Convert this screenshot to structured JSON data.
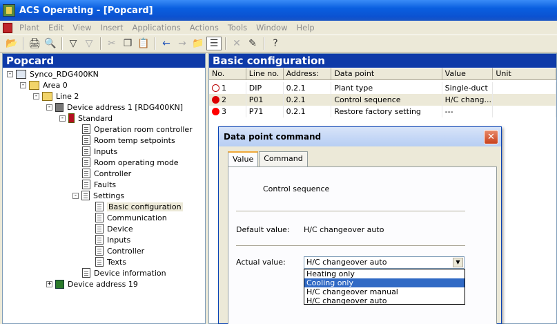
{
  "window": {
    "title": "ACS Operating - [Popcard]"
  },
  "menu": [
    "Plant",
    "Edit",
    "View",
    "Insert",
    "Applications",
    "Actions",
    "Tools",
    "Window",
    "Help"
  ],
  "left": {
    "header": "Popcard",
    "tree": {
      "root": "Synco_RDG400KN",
      "area": "Area 0",
      "line": "Line 2",
      "device": "Device address 1 [RDG400KN]",
      "standard": "Standard",
      "items": [
        "Operation room controller",
        "Room temp setpoints",
        "Inputs",
        "Room operating mode",
        "Controller",
        "Faults",
        "Settings"
      ],
      "settings": [
        "Basic configuration",
        "Communication",
        "Device",
        "Inputs",
        "Controller",
        "Texts"
      ],
      "devinfo": "Device information",
      "device19": "Device address 19"
    }
  },
  "right": {
    "header": "Basic configuration",
    "columns": [
      "No.",
      "Line no.",
      "Address:",
      "Data point",
      "Value",
      "Unit"
    ],
    "rows": [
      {
        "no": "1",
        "line": "DIP",
        "addr": "0.2.1",
        "dp": "Plant type",
        "value": "Single-duct",
        "unit": ""
      },
      {
        "no": "2",
        "line": "P01",
        "addr": "0.2.1",
        "dp": "Control sequence",
        "value": "H/C chang...",
        "unit": ""
      },
      {
        "no": "3",
        "line": "P71",
        "addr": "0.2.1",
        "dp": "Restore factory setting",
        "value": "---",
        "unit": ""
      }
    ]
  },
  "dialog": {
    "title": "Data point command",
    "tabs": [
      "Value",
      "Command"
    ],
    "caption": "Control sequence",
    "default_label": "Default value:",
    "default_value": "H/C changeover auto",
    "actual_label": "Actual value:",
    "actual_value": "H/C changeover auto",
    "options": [
      "Heating only",
      "Cooling only",
      "H/C changeover manual",
      "H/C changeover auto"
    ]
  }
}
